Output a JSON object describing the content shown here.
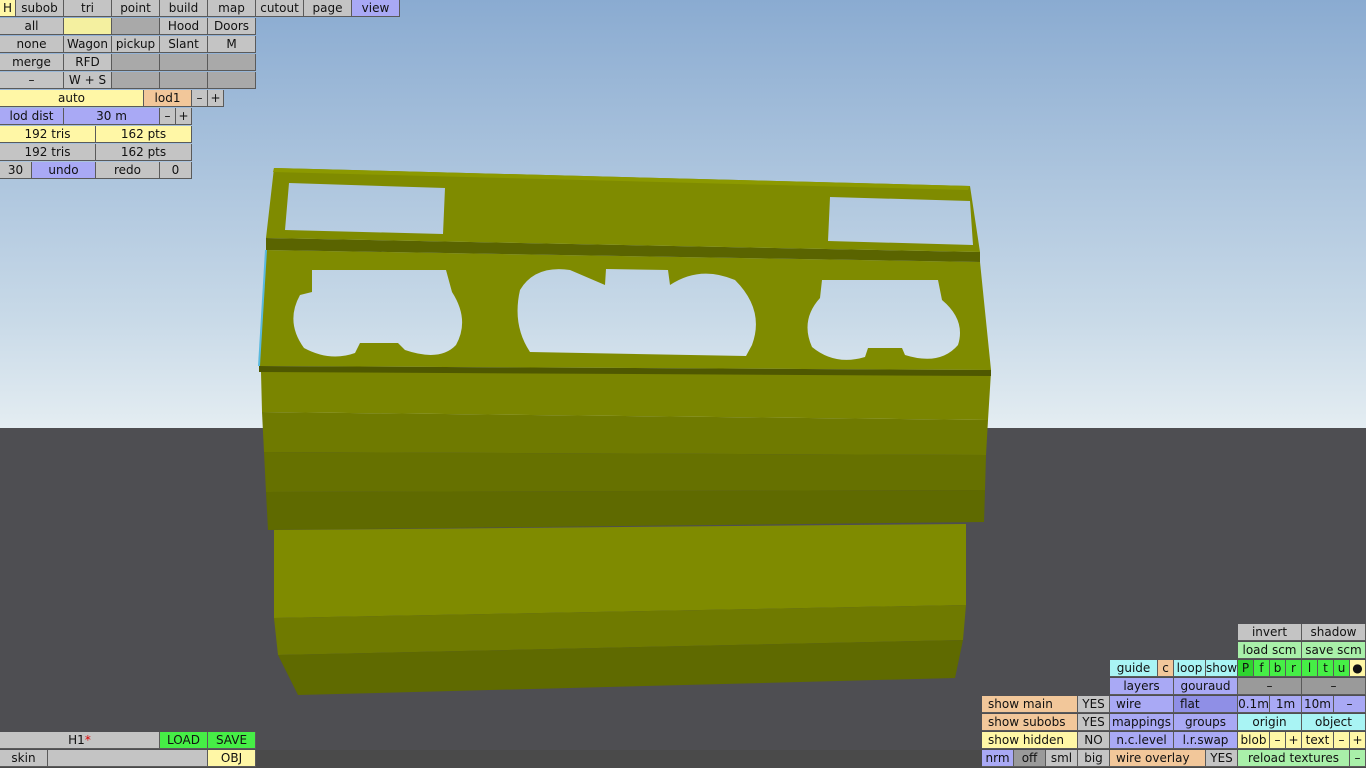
{
  "colors": {
    "sky_top": "#8fb0d4",
    "sky_bottom": "#dbe7ef",
    "ground": "#4e4e52",
    "model_olive": "#7f8b00",
    "model_shadow": "#5f6a00"
  },
  "top_menu": {
    "h": "H",
    "subob": "subob",
    "tri": "tri",
    "point": "point",
    "build": "build",
    "map": "map",
    "cutout": "cutout",
    "page": "page",
    "view": "view"
  },
  "subobj_grid": {
    "all": "all",
    "hood": "Hood",
    "doors": "Doors",
    "none": "none",
    "wagon": "Wagon",
    "pickup": "pickup",
    "slant": "Slant",
    "m": "M",
    "merge": "merge",
    "rfd": "RFD",
    "dash": "–",
    "ws": "W + S"
  },
  "lod": {
    "auto": "auto",
    "lod1": "lod1",
    "minus": "–",
    "plus": "+",
    "dist_label": "lod dist",
    "dist_value": "30 m"
  },
  "stats": {
    "tris1": "192 tris",
    "pts1": "162 pts",
    "tris2": "192 tris",
    "pts2": "162 pts"
  },
  "undo": {
    "count": "30",
    "undo": "undo",
    "redo": "redo",
    "redo_count": "0"
  },
  "file": {
    "name": "H1",
    "modified_mark": "*",
    "load": "LOAD",
    "save": "SAVE",
    "skin": "skin",
    "obj": "OBJ"
  },
  "view_panel": {
    "invert": "invert",
    "shadow": "shadow",
    "load_scm": "load scm",
    "save_scm": "save scm",
    "guide": "guide",
    "c": "c",
    "loop": "loop",
    "show": "show",
    "pfbrltu": [
      "P",
      "f",
      "b",
      "r",
      "l",
      "t",
      "u"
    ],
    "dot": "●",
    "layers": "layers",
    "gouraud": "gouraud",
    "dash1": "–",
    "dash2": "–",
    "show_main": "show main",
    "show_main_val": "YES",
    "wire": "wire",
    "flat": "flat",
    "d01": "0.1m",
    "d1": "1m",
    "d10": "10m",
    "dminus": "–",
    "show_subobs": "show subobs",
    "show_subobs_val": "YES",
    "mappings": "mappings",
    "groups": "groups",
    "origin": "origin",
    "object": "object",
    "show_hidden": "show hidden",
    "show_hidden_val": "NO",
    "nc_level": "n.c.level",
    "lr_swap": "l.r.swap",
    "blob": "blob",
    "blob_minus": "–",
    "blob_plus": "+",
    "text": "text",
    "text_minus": "–",
    "text_plus": "+",
    "nrm": "nrm",
    "off": "off",
    "sml": "sml",
    "big": "big",
    "wire_overlay": "wire overlay",
    "wire_overlay_val": "YES",
    "reload_textures": "reload textures",
    "rt_minus": "–"
  }
}
